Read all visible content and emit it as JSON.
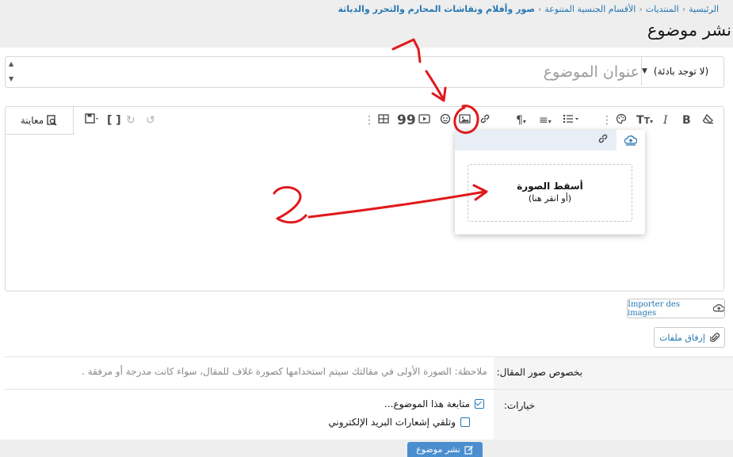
{
  "breadcrumb": {
    "items": [
      "الرئيسية",
      "المنتديات",
      "الأقسام الجنسية المتنوعة",
      "صور وأفلام ونقاشات المحارم والتحرر والدياثة"
    ]
  },
  "page": {
    "title": "نشر موضوع"
  },
  "thread_title": {
    "placeholder": "عنوان الموضوع",
    "prefix": "(لا توجد بادئة)"
  },
  "editor": {
    "preview_label": "معاينة"
  },
  "image_popup": {
    "drop_label": "أسقط الصورة",
    "drop_hint": "(أو انقر هنا)"
  },
  "buttons": {
    "import_images": "Importer des images",
    "attach_files": "إرفاق ملفات",
    "submit": "نشر موضوع"
  },
  "form": {
    "images_label": "بخصوص صور المقال:",
    "images_note": "ملاحظة: الصورة الأولى في مقالتك سيتم استخدامها كصورة غلاف للمقال، سواء كانت مدرجة أو مرفقة .",
    "options_label": "خيارات:",
    "watch_label": "متابعة هذا الموضوع...",
    "watch_checked": true,
    "email_label": "وتلقي إشعارات البريد الإلكتروني",
    "email_checked": false
  },
  "annotations": {
    "mark_1": "1",
    "mark_2": "2",
    "color": "#e0191c"
  },
  "colors": {
    "link": "#2577b1",
    "submit_bg": "#4a8ed0"
  }
}
